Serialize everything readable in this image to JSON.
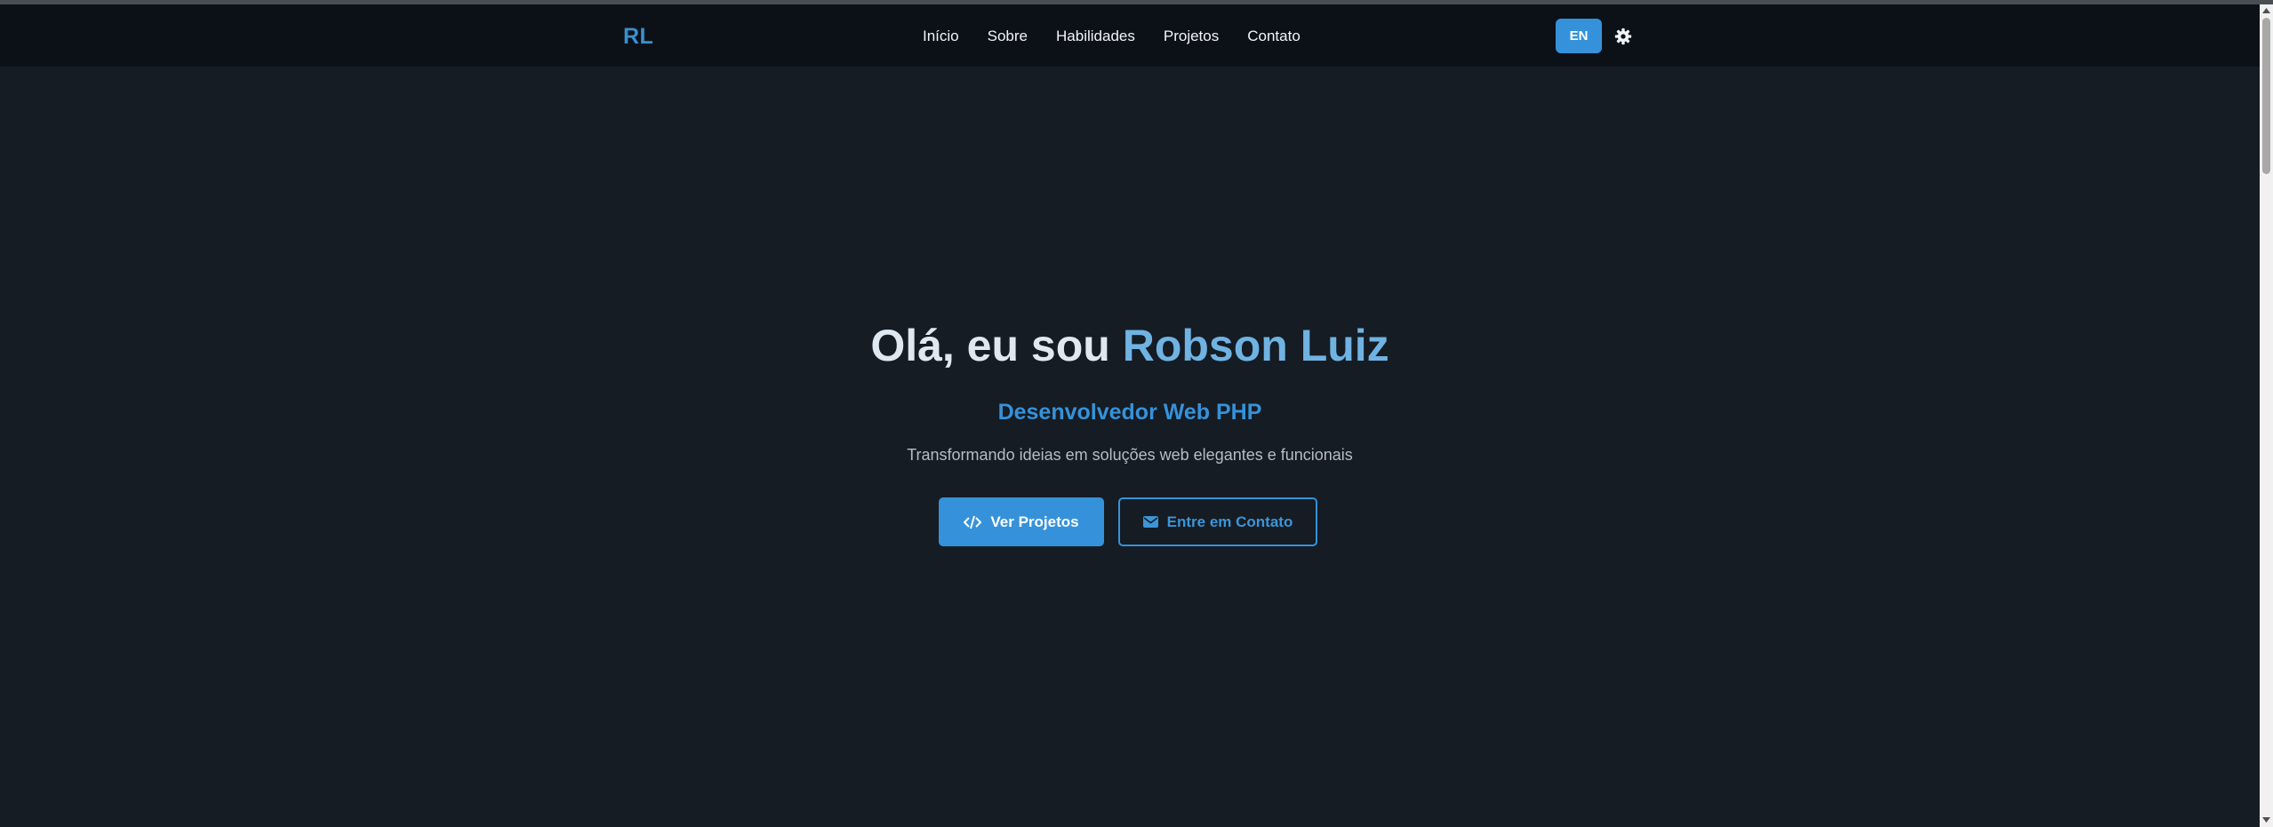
{
  "nav": {
    "logo": "RL",
    "links": [
      "Início",
      "Sobre",
      "Habilidades",
      "Projetos",
      "Contato"
    ],
    "lang_button": "EN",
    "theme_icon": "gear-icon"
  },
  "hero": {
    "greeting": "Olá, eu sou ",
    "name": "Robson Luiz",
    "subtitle": "Desenvolvedor Web PHP",
    "tagline": "Transformando ideias em soluções web elegantes e funcionais",
    "primary_button": "Ver Projetos",
    "primary_icon": "code-icon",
    "secondary_button": "Entre em Contato",
    "secondary_icon": "envelope-icon"
  },
  "colors": {
    "background": "#161c24",
    "navbar": "#0c1118",
    "accent": "#3592da",
    "name_highlight": "#6fb3e2"
  }
}
